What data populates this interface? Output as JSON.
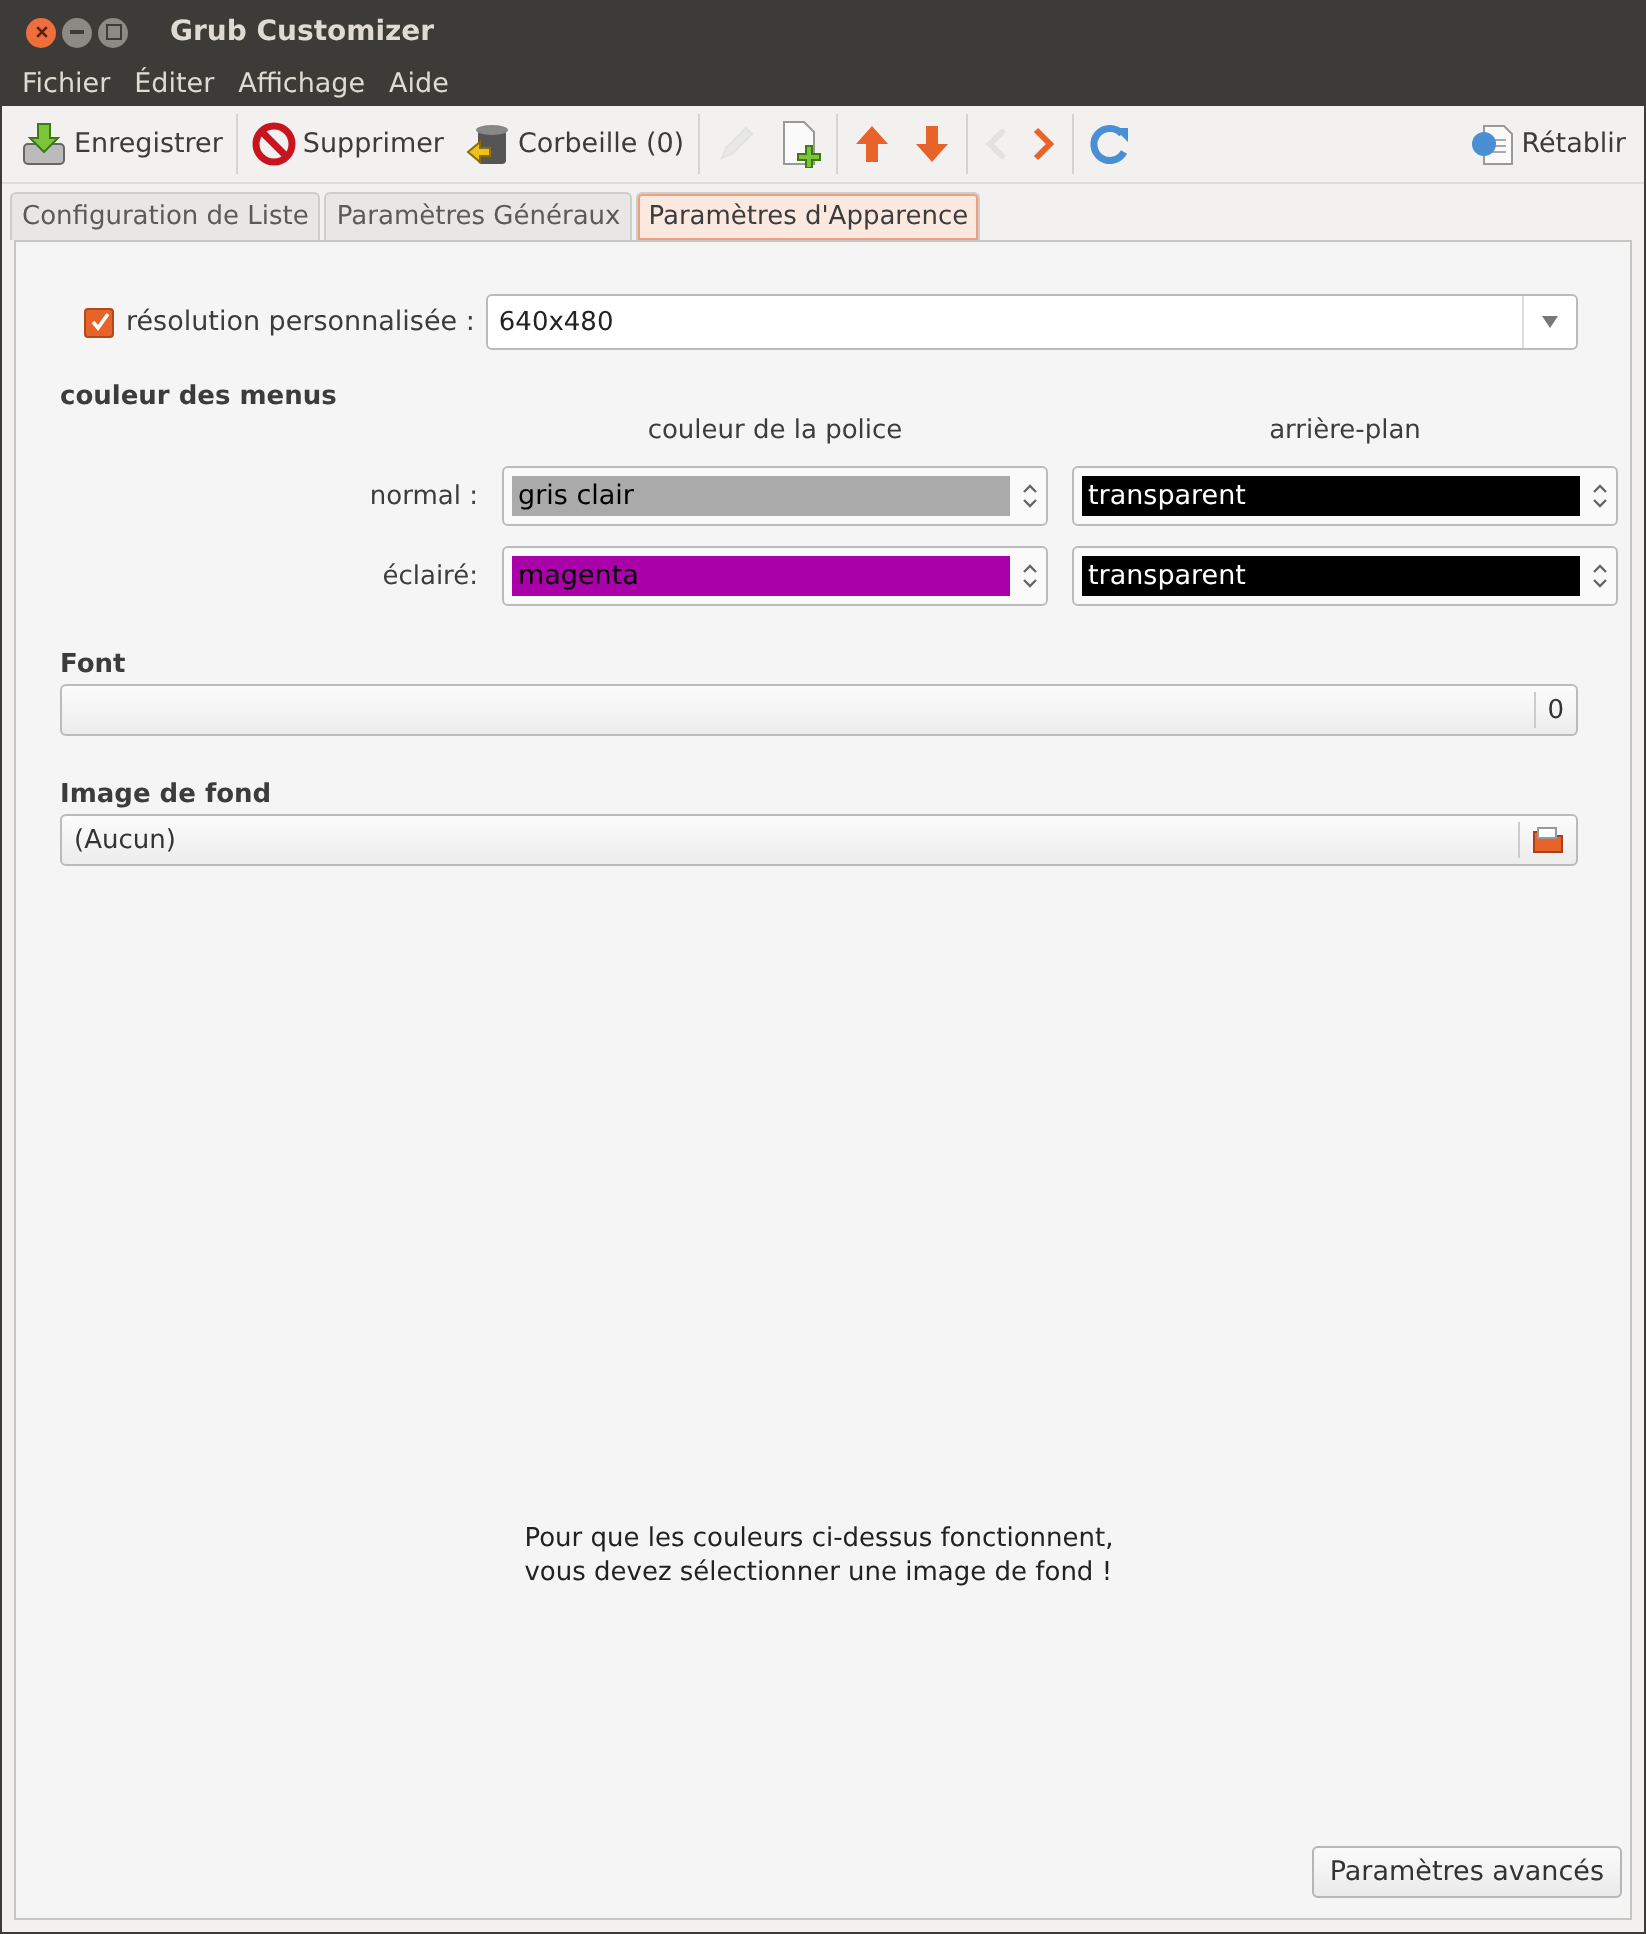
{
  "window": {
    "title": "Grub Customizer"
  },
  "menu": [
    "Fichier",
    "Éditer",
    "Affichage",
    "Aide"
  ],
  "toolbar": [
    {
      "kind": "save",
      "label": "Enregistrer",
      "disabled": false
    },
    {
      "kind": "delete",
      "label": "Supprimer",
      "disabled": false
    },
    {
      "kind": "trash",
      "label": "Corbeille (0)",
      "disabled": false
    },
    {
      "kind": "edit",
      "disabled": true
    },
    {
      "kind": "new",
      "disabled": false
    },
    {
      "kind": "up",
      "disabled": false
    },
    {
      "kind": "down",
      "disabled": false
    },
    {
      "kind": "back",
      "disabled": true
    },
    {
      "kind": "forward",
      "disabled": false
    },
    {
      "kind": "reload",
      "disabled": false
    },
    {
      "kind": "revert",
      "label": "Rétablir",
      "disabled": false
    }
  ],
  "tabs": [
    {
      "label": "Configuration de Liste",
      "selected": false
    },
    {
      "label": "Paramètres Généraux",
      "selected": false
    },
    {
      "label": "Paramètres d'Apparence",
      "selected": true
    }
  ],
  "resolution": {
    "label": "résolution personnalisée :",
    "checked": true,
    "value": "640x480"
  },
  "menu_colors": {
    "title": "couleur des menus",
    "columns": [
      "couleur de la police",
      "arrière-plan"
    ],
    "rows": [
      {
        "label": "normal :",
        "font": {
          "value": "gris clair",
          "color": "#aaaaaa"
        },
        "background": {
          "value": "transparent",
          "color": "#000000"
        }
      },
      {
        "label": "éclairé:",
        "font": {
          "value": "magenta",
          "color": "#aa00aa"
        },
        "background": {
          "value": "transparent",
          "color": "#000000"
        }
      }
    ]
  },
  "font": {
    "title": "Font",
    "value": "0"
  },
  "background_image": {
    "title": "Image de fond",
    "value": "(Aucun)"
  },
  "notice": [
    "Pour que les couleurs ci-dessus fonctionnent,",
    "vous devez sélectionner une image de fond !"
  ],
  "advanced_button": "Paramètres avancés"
}
